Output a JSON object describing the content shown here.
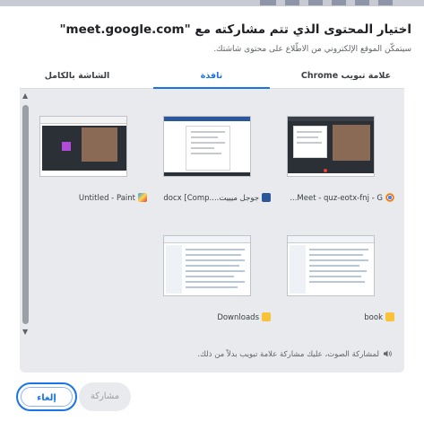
{
  "dialog": {
    "title": "اختيار المحتوى الذي تتم مشاركته مع \"meet.google.com\"",
    "subtitle": "سيتمكّن الموقع الإلكتروني من الاطّلاع على محتوى شاشتك."
  },
  "tabs": [
    {
      "label": "علامة تبويب Chrome",
      "active": false
    },
    {
      "label": "نافذة",
      "active": true
    },
    {
      "label": "الشاشة بالكامل",
      "active": false
    }
  ],
  "windows": [
    {
      "label": "Meet - quz-eotx-fnj - G...",
      "icon": "chrome-icon"
    },
    {
      "label": "جوجل ميييت....docx [Comp",
      "icon": "word-icon"
    },
    {
      "label": "Untitled - Paint",
      "icon": "paint-icon"
    },
    {
      "label": "book",
      "icon": "folder-icon"
    },
    {
      "label": "Downloads",
      "icon": "folder-icon"
    }
  ],
  "audio_note": "لمشاركة الصوت، عليك مشاركة علامة تبويب بدلاً من ذلك.",
  "buttons": {
    "share": "مشاركة",
    "cancel": "إلغاء"
  },
  "colors": {
    "accent": "#1a73e8",
    "panel": "#e8eaed",
    "disabled": "#9aa0a6"
  }
}
